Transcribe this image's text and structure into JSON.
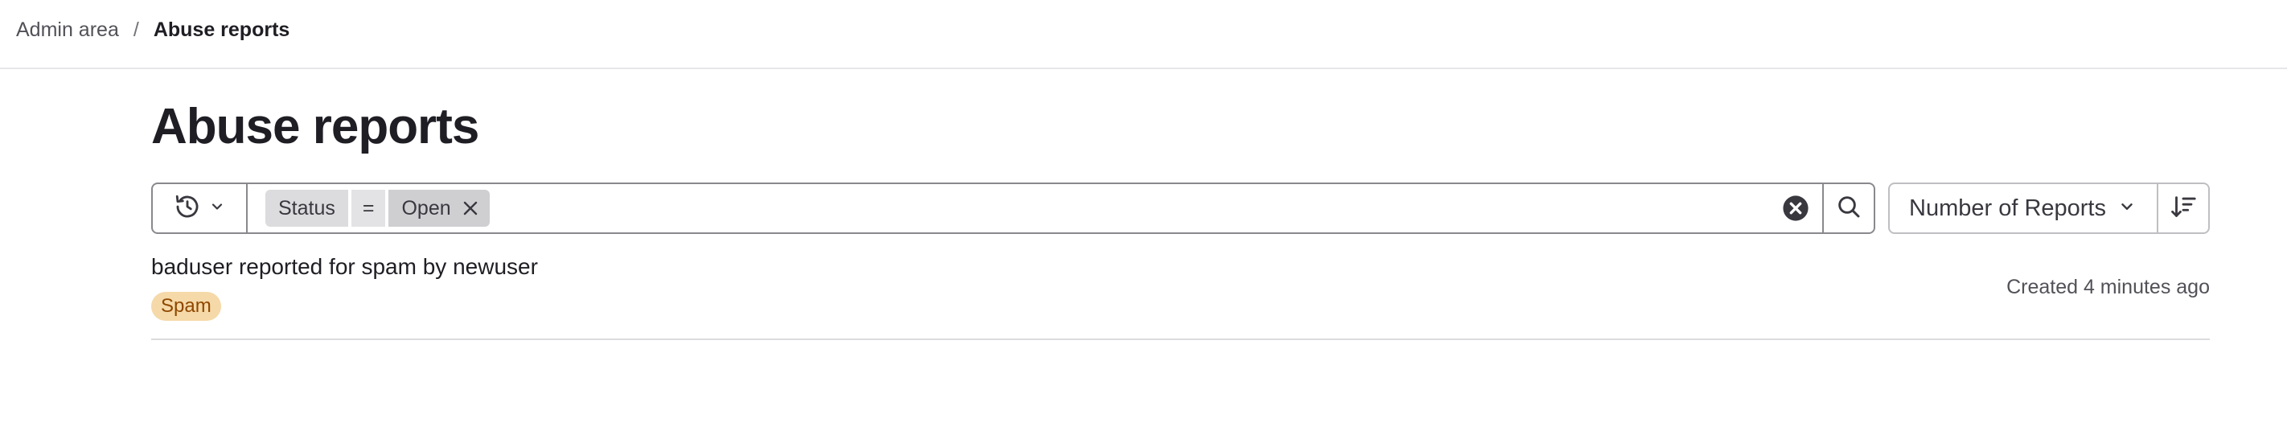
{
  "breadcrumb": {
    "parent": "Admin area",
    "separator": "/",
    "current": "Abuse reports"
  },
  "page": {
    "title": "Abuse reports"
  },
  "filter": {
    "history_icon": "history-icon",
    "token": {
      "key": "Status",
      "operator": "=",
      "value": "Open"
    },
    "clear_icon": "clear-icon",
    "search_icon": "search-icon"
  },
  "sort": {
    "label": "Number of Reports",
    "direction_icon": "sort-descending-icon"
  },
  "reports": [
    {
      "title": "baduser reported for spam by newuser",
      "category": "Spam",
      "created": "Created 4 minutes ago"
    }
  ],
  "colors": {
    "badge_bg": "#f5d9a8",
    "badge_text": "#8f4700",
    "border": "#89888d"
  }
}
